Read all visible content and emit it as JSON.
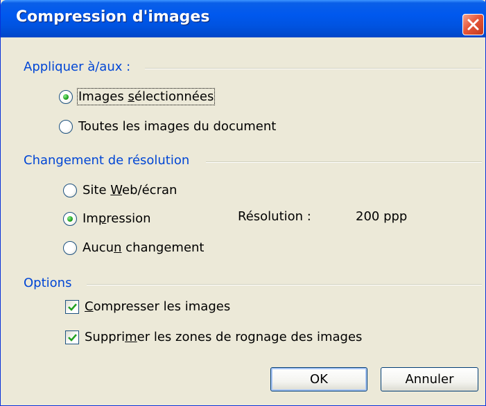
{
  "window": {
    "title": "Compression d'images"
  },
  "apply_group": {
    "label": "Appliquer à/aux :",
    "options": [
      {
        "pre": "Images ",
        "acc": "s",
        "post": "électionnées",
        "checked": true
      },
      {
        "pre": "Toutes les ima",
        "acc": "g",
        "post": "es du document",
        "checked": false
      }
    ]
  },
  "resolution_group": {
    "label": "Changement de résolution",
    "options": [
      {
        "pre": "Site ",
        "acc": "W",
        "post": "eb/écran",
        "checked": false
      },
      {
        "pre": "Im",
        "acc": "p",
        "post": "ression",
        "checked": true
      },
      {
        "pre": "Aucu",
        "acc": "n",
        "post": " changement",
        "checked": false
      }
    ],
    "resolution_label": "Résolution :",
    "resolution_value": "200 ppp"
  },
  "options_group": {
    "label": "Options",
    "options": [
      {
        "pre": "",
        "acc": "C",
        "post": "ompresser les images",
        "checked": true
      },
      {
        "pre": "Suppri",
        "acc": "m",
        "post": "er les zones de rognage des images",
        "checked": true
      }
    ]
  },
  "buttons": {
    "ok": "OK",
    "cancel": "Annuler"
  }
}
